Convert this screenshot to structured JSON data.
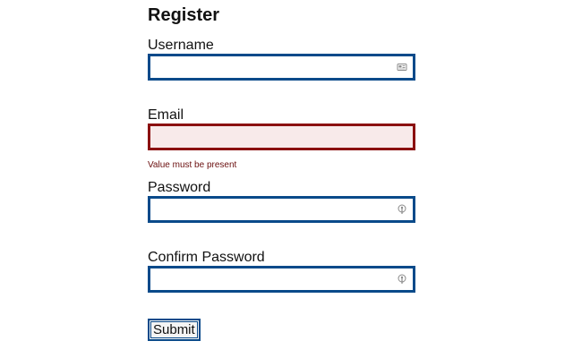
{
  "form": {
    "title": "Register",
    "submit_label": "Submit"
  },
  "fields": {
    "username": {
      "label": "Username",
      "value": "",
      "icon": "contact-card-icon"
    },
    "email": {
      "label": "Email",
      "value": "",
      "error": "Value must be present",
      "invalid": true
    },
    "password": {
      "label": "Password",
      "value": "",
      "icon": "password-key-icon"
    },
    "confirm_password": {
      "label": "Confirm Password",
      "value": "",
      "icon": "password-key-icon"
    }
  },
  "colors": {
    "input_border": "#0a4a8a",
    "invalid_border": "#8b1010",
    "invalid_background": "#f8eaea",
    "error_text": "#6a0e0e"
  }
}
